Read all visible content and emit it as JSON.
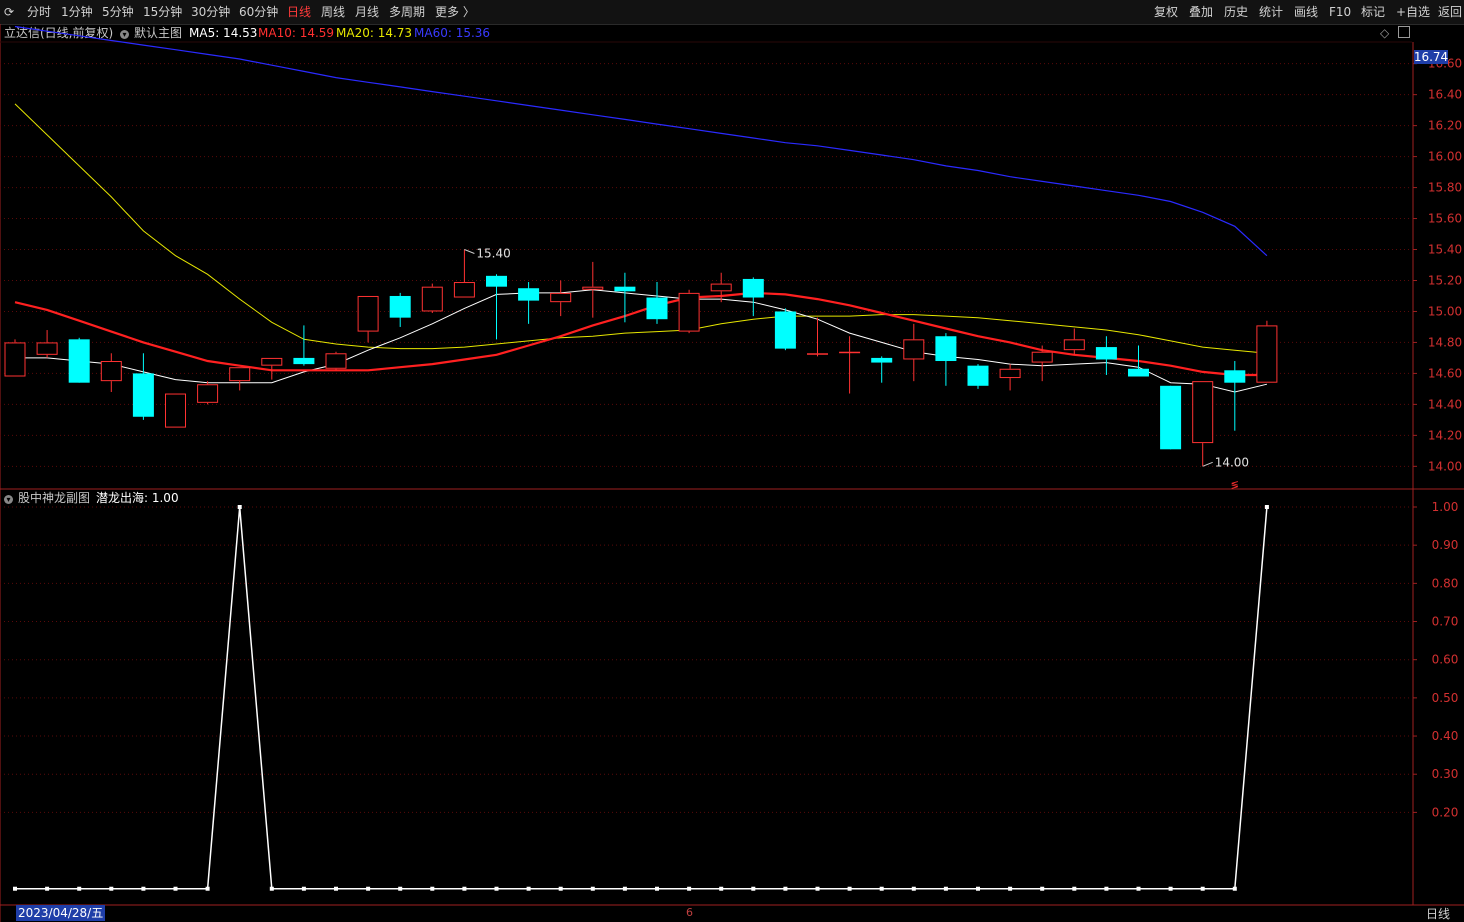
{
  "toolbar": {
    "left_items": [
      "分时",
      "1分钟",
      "5分钟",
      "15分钟",
      "30分钟",
      "60分钟",
      "日线",
      "周线",
      "月线",
      "多周期",
      "更多 〉"
    ],
    "active": "日线",
    "right_items": [
      "复权",
      "叠加",
      "历史",
      "统计",
      "画线",
      "F10",
      "标记",
      "+自选",
      "返回"
    ]
  },
  "main_chart": {
    "title": "立达信(日线,前复权)",
    "template": "默认主图",
    "ma5_label": "MA5: 14.53",
    "ma10_label": "MA10: 14.59",
    "ma20_label": "MA20: 14.73",
    "ma60_label": "MA60: 15.36"
  },
  "sub_chart": {
    "title": "股中神龙副图",
    "indicator_label": "潜龙出海: 1.00"
  },
  "bottom": {
    "date": "2023/04/28/五",
    "tick": "6",
    "period": "日线"
  },
  "colors": {
    "up": "#ff3232",
    "down": "#00ffff",
    "ma5": "#ffffff",
    "ma10": "#ff2020",
    "ma20": "#e6e600",
    "ma60": "#2a2aff",
    "axis": "#a02020",
    "grid": "#5a0a0a"
  },
  "chart_data": [
    {
      "type": "candlestick",
      "title": "立达信(日线,前复权)",
      "y_ticks": [
        14.0,
        14.2,
        14.4,
        14.6,
        14.8,
        15.0,
        15.2,
        15.4,
        15.6,
        15.8,
        16.0,
        16.2,
        16.4,
        16.6
      ],
      "y_top_label": "16.74",
      "ylim": [
        13.86,
        16.74
      ],
      "max_annotation": "15.40",
      "min_annotation": "14.00",
      "candles": [
        {
          "o": 14.58,
          "h": 14.82,
          "l": 14.58,
          "c": 14.8
        },
        {
          "o": 14.72,
          "h": 14.88,
          "l": 14.7,
          "c": 14.8
        },
        {
          "o": 14.82,
          "h": 14.83,
          "l": 14.54,
          "c": 14.54
        },
        {
          "o": 14.55,
          "h": 14.73,
          "l": 14.48,
          "c": 14.68
        },
        {
          "o": 14.6,
          "h": 14.73,
          "l": 14.3,
          "c": 14.32
        },
        {
          "o": 14.25,
          "h": 14.47,
          "l": 14.25,
          "c": 14.47
        },
        {
          "o": 14.41,
          "h": 14.55,
          "l": 14.4,
          "c": 14.53
        },
        {
          "o": 14.55,
          "h": 14.64,
          "l": 14.49,
          "c": 14.64
        },
        {
          "o": 14.65,
          "h": 14.7,
          "l": 14.56,
          "c": 14.7
        },
        {
          "o": 14.7,
          "h": 14.91,
          "l": 14.65,
          "c": 14.66
        },
        {
          "o": 14.63,
          "h": 14.74,
          "l": 14.62,
          "c": 14.73
        },
        {
          "o": 14.87,
          "h": 15.1,
          "l": 14.8,
          "c": 15.1
        },
        {
          "o": 15.1,
          "h": 15.12,
          "l": 14.9,
          "c": 14.96
        },
        {
          "o": 15.0,
          "h": 15.18,
          "l": 14.99,
          "c": 15.16
        },
        {
          "o": 15.09,
          "h": 15.4,
          "l": 15.09,
          "c": 15.19
        },
        {
          "o": 15.23,
          "h": 15.24,
          "l": 14.82,
          "c": 15.16
        },
        {
          "o": 15.15,
          "h": 15.19,
          "l": 14.92,
          "c": 15.07
        },
        {
          "o": 15.06,
          "h": 15.2,
          "l": 14.97,
          "c": 15.12
        },
        {
          "o": 15.14,
          "h": 15.32,
          "l": 14.96,
          "c": 15.16
        },
        {
          "o": 15.16,
          "h": 15.25,
          "l": 14.93,
          "c": 15.13
        },
        {
          "o": 15.09,
          "h": 15.19,
          "l": 14.92,
          "c": 14.95
        },
        {
          "o": 14.87,
          "h": 15.14,
          "l": 14.86,
          "c": 15.12
        },
        {
          "o": 15.13,
          "h": 15.25,
          "l": 15.06,
          "c": 15.18
        },
        {
          "o": 15.21,
          "h": 15.22,
          "l": 14.97,
          "c": 15.09
        },
        {
          "o": 15.0,
          "h": 15.02,
          "l": 14.75,
          "c": 14.76
        },
        {
          "o": 14.73,
          "h": 14.96,
          "l": 14.71,
          "c": 14.73
        },
        {
          "o": 14.74,
          "h": 14.84,
          "l": 14.47,
          "c": 14.74
        },
        {
          "o": 14.7,
          "h": 14.71,
          "l": 14.54,
          "c": 14.67
        },
        {
          "o": 14.69,
          "h": 14.92,
          "l": 14.55,
          "c": 14.82
        },
        {
          "o": 14.84,
          "h": 14.86,
          "l": 14.52,
          "c": 14.68
        },
        {
          "o": 14.65,
          "h": 14.66,
          "l": 14.5,
          "c": 14.52
        },
        {
          "o": 14.57,
          "h": 14.66,
          "l": 14.49,
          "c": 14.63
        },
        {
          "o": 14.67,
          "h": 14.78,
          "l": 14.55,
          "c": 14.74
        },
        {
          "o": 14.75,
          "h": 14.89,
          "l": 14.72,
          "c": 14.82
        },
        {
          "o": 14.77,
          "h": 14.84,
          "l": 14.59,
          "c": 14.69
        },
        {
          "o": 14.63,
          "h": 14.78,
          "l": 14.58,
          "c": 14.58
        },
        {
          "o": 14.52,
          "h": 14.52,
          "l": 14.11,
          "c": 14.11
        },
        {
          "o": 14.15,
          "h": 14.55,
          "l": 14.0,
          "c": 14.55
        },
        {
          "o": 14.62,
          "h": 14.68,
          "l": 14.23,
          "c": 14.54
        },
        {
          "o": 14.54,
          "h": 14.94,
          "l": 14.54,
          "c": 14.91
        }
      ],
      "series": [
        {
          "name": "MA5",
          "values": [
            14.7,
            14.7,
            14.68,
            14.66,
            14.61,
            14.56,
            14.54,
            14.54,
            14.54,
            14.61,
            14.66,
            14.75,
            14.83,
            14.92,
            15.02,
            15.11,
            15.12,
            15.12,
            15.14,
            15.12,
            15.1,
            15.08,
            15.08,
            15.06,
            15.01,
            14.95,
            14.86,
            14.8,
            14.74,
            14.71,
            14.69,
            14.66,
            14.65,
            14.66,
            14.67,
            14.64,
            14.54,
            14.53,
            14.48,
            14.53
          ]
        },
        {
          "name": "MA10",
          "values": [
            15.06,
            15.01,
            14.94,
            14.87,
            14.8,
            14.74,
            14.68,
            14.65,
            14.62,
            14.62,
            14.62,
            14.62,
            14.64,
            14.66,
            14.69,
            14.72,
            14.78,
            14.84,
            14.91,
            14.97,
            15.04,
            15.09,
            15.1,
            15.12,
            15.11,
            15.08,
            15.04,
            14.99,
            14.94,
            14.89,
            14.84,
            14.8,
            14.75,
            14.72,
            14.7,
            14.68,
            14.65,
            14.61,
            14.59,
            14.59
          ]
        },
        {
          "name": "MA20",
          "values": [
            16.34,
            16.14,
            15.94,
            15.74,
            15.52,
            15.36,
            15.24,
            15.08,
            14.93,
            14.82,
            14.79,
            14.77,
            14.76,
            14.76,
            14.77,
            14.79,
            14.81,
            14.83,
            14.84,
            14.86,
            14.87,
            14.88,
            14.92,
            14.95,
            14.97,
            14.97,
            14.97,
            14.98,
            14.98,
            14.97,
            14.96,
            14.94,
            14.92,
            14.9,
            14.88,
            14.85,
            14.81,
            14.77,
            14.75,
            14.73
          ]
        },
        {
          "name": "MA60",
          "values": [
            16.84,
            16.81,
            16.78,
            16.75,
            16.72,
            16.69,
            16.66,
            16.63,
            16.59,
            16.55,
            16.51,
            16.48,
            16.45,
            16.42,
            16.39,
            16.36,
            16.33,
            16.3,
            16.27,
            16.24,
            16.21,
            16.18,
            16.15,
            16.12,
            16.09,
            16.07,
            16.04,
            16.01,
            15.98,
            15.94,
            15.91,
            15.87,
            15.84,
            15.81,
            15.78,
            15.75,
            15.71,
            15.64,
            15.55,
            15.36
          ]
        }
      ]
    },
    {
      "type": "line",
      "title": "股中神龙副图",
      "series": [
        {
          "name": "潜龙出海",
          "values": [
            0,
            0,
            0,
            0,
            0,
            0,
            0,
            1,
            0,
            0,
            0,
            0,
            0,
            0,
            0,
            0,
            0,
            0,
            0,
            0,
            0,
            0,
            0,
            0,
            0,
            0,
            0,
            0,
            0,
            0,
            0,
            0,
            0,
            0,
            0,
            0,
            0,
            0,
            0,
            1
          ]
        }
      ],
      "y_ticks": [
        0.2,
        0.3,
        0.4,
        0.5,
        0.6,
        0.7,
        0.8,
        0.9,
        1.0
      ],
      "ylim": [
        -0.04,
        1.0
      ]
    }
  ]
}
